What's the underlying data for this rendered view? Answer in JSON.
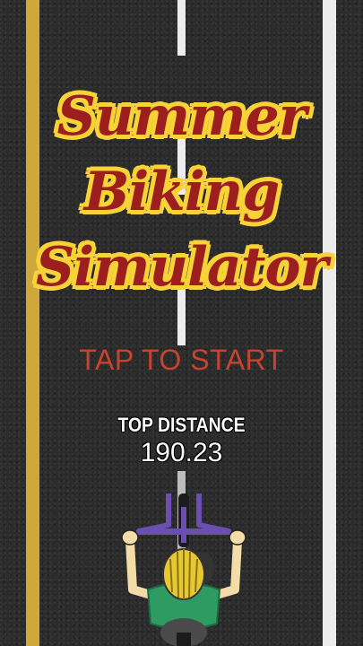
{
  "game": {
    "title_lines": [
      "Summer",
      "Biking",
      "Simulator"
    ],
    "start_prompt": "TAP TO START",
    "top_distance_label": "TOP DISTANCE",
    "top_distance_value": "190.23"
  },
  "colors": {
    "asphalt": "#2b2b2b",
    "left_edge_line": "#cfa83a",
    "right_edge_line": "#ececec",
    "title_fill": "#9c1e1e",
    "title_outline": "#f7d338",
    "start_prompt": "#c7432e",
    "helmet": "#e8c832",
    "handlebar": "#6a4fb0",
    "shirt": "#2e9b63"
  },
  "icons": {
    "player": "cyclist-top-down-icon"
  }
}
